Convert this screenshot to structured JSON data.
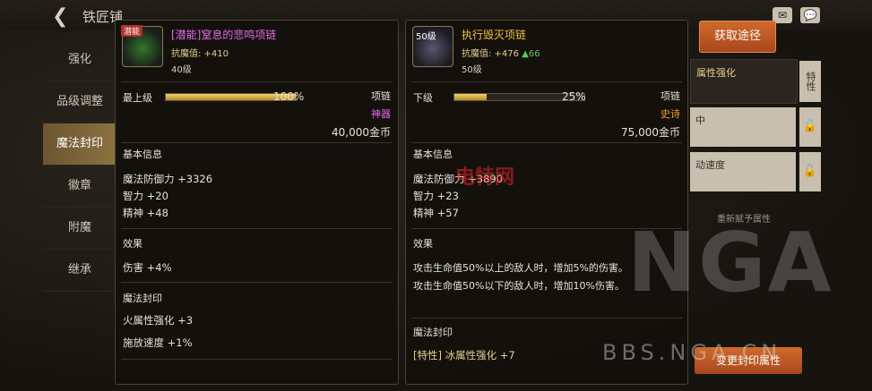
{
  "header": {
    "title": "铁匠铺",
    "back": "❮",
    "stat_icons": [
      "✉",
      "💬"
    ]
  },
  "sidebar": {
    "items": [
      {
        "label": "强化"
      },
      {
        "label": "品级调整"
      },
      {
        "label": "魔法封印"
      },
      {
        "label": "徽章"
      },
      {
        "label": "附魔"
      },
      {
        "label": "继承"
      }
    ],
    "active_index": 2
  },
  "card1": {
    "badge": "潜能",
    "name": "[潜能]窒息的悲鸣项链",
    "name_color": "#e06ce8",
    "sub": "抗魔值: +410",
    "level": "40级",
    "grade_label": "最上级",
    "grade_pct": "100%",
    "grade_fraction": 1.0,
    "slot": "项链",
    "rarity": "神器",
    "rarity_color": "#e06ce8",
    "price": "40,000金币",
    "basic_title": "基本信息",
    "basic": [
      "魔法防御力 +3326",
      "智力 +20",
      "精神 +48"
    ],
    "effect_title": "效果",
    "effects": [
      "伤害 +4%"
    ],
    "seal_title": "魔法封印",
    "seals": [
      "火属性强化 +3",
      "施放速度 +1%"
    ]
  },
  "card2": {
    "icon_level": "50级",
    "name": "执行毁灭项链",
    "name_color": "#f0c040",
    "sub_prefix": "抗魔值: +476",
    "sub_up": "▲66",
    "level": "50级",
    "grade_label": "下级",
    "grade_pct": "25%",
    "grade_fraction": 0.25,
    "slot": "项链",
    "rarity": "史诗",
    "rarity_color": "#f0a030",
    "price": "75,000金币",
    "basic_title": "基本信息",
    "basic": [
      "魔法防御力 +3890",
      "智力 +23",
      "精神 +57"
    ],
    "effect_title": "效果",
    "effects": [
      "攻击生命值50%以上的敌人时，增加5%的伤害。",
      "攻击生命值50%以下的敌人时，增加10%伤害。"
    ],
    "seal_title": "魔法封印",
    "seals": [
      "[特性] 冰属性强化 +7"
    ]
  },
  "right": {
    "obtain_button": "获取途径",
    "panel1": "属性强化",
    "panel1_tag": "特性",
    "panel2": "中",
    "panel3": "动速度",
    "refresh": "重新赋予属性",
    "bottom_button": "变更封印属性"
  },
  "watermark": {
    "site": "BBS.NGA.CN",
    "logo": "NGA",
    "red": "电特网"
  }
}
